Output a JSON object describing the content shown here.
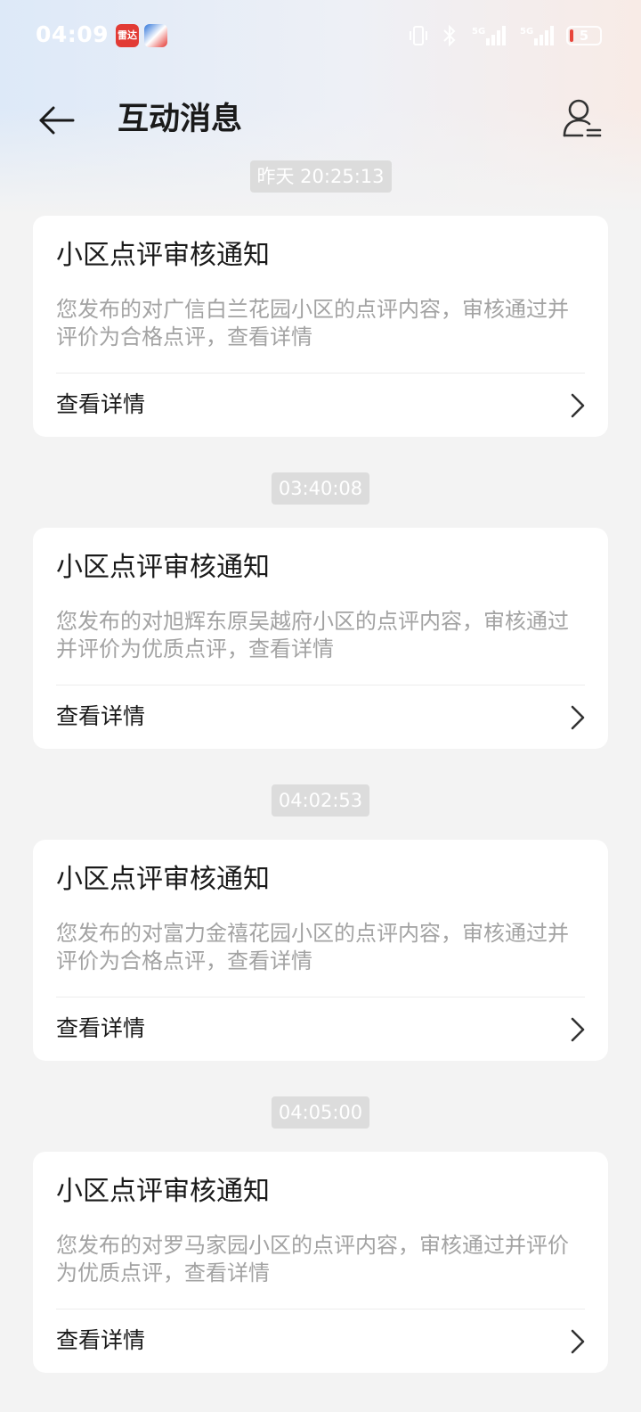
{
  "status_bar": {
    "time": "04:09",
    "app_icon_1": "雷达",
    "battery_level": "5",
    "network_1": "5G",
    "network_2": "5G",
    "icons": [
      "vibrate-icon",
      "bluetooth-icon",
      "signal-5g-icon",
      "signal-5g-icon",
      "battery-icon"
    ]
  },
  "header": {
    "title": "互动消息",
    "back_icon": "arrow-left-icon",
    "profile_icon": "user-settings-icon"
  },
  "messages": [
    {
      "timestamp": "昨天 20:25:13",
      "title": "小区点评审核通知",
      "body": "您发布的对广信白兰花园小区的点评内容，审核通过并评价为合格点评，查看详情",
      "action_label": "查看详情"
    },
    {
      "timestamp": "03:40:08",
      "title": "小区点评审核通知",
      "body": "您发布的对旭辉东原吴越府小区的点评内容，审核通过并评价为优质点评，查看详情",
      "action_label": "查看详情"
    },
    {
      "timestamp": "04:02:53",
      "title": "小区点评审核通知",
      "body": "您发布的对富力金禧花园小区的点评内容，审核通过并评价为合格点评，查看详情",
      "action_label": "查看详情"
    },
    {
      "timestamp": "04:05:00",
      "title": "小区点评审核通知",
      "body": "您发布的对罗马家园小区的点评内容，审核通过并评价为优质点评，查看详情",
      "action_label": "查看详情"
    }
  ],
  "colors": {
    "timestamp_bg": "#dcdcdc",
    "body_text": "#a3a3a3",
    "battery_low": "#e8443a"
  }
}
